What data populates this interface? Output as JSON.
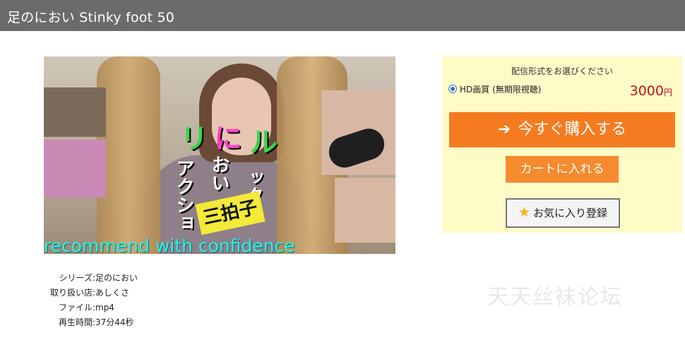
{
  "header": {
    "title": "足のにおい Stinky foot 50"
  },
  "thumbnail": {
    "overlay_green": "リ",
    "overlay_pink": "に",
    "overlay_green2": "ル",
    "overlay_white1": "アクショ",
    "overlay_white2": "おい",
    "overlay_white3": "ックス",
    "badge": "三拍子",
    "caption": "recommend with confidence"
  },
  "info": [
    {
      "label": "シリーズ",
      "value": "足のにおい",
      "link": true
    },
    {
      "label": "取り扱い店",
      "value": "あしくさ",
      "link": true
    },
    {
      "label": "ファイル",
      "value": "mp4",
      "link": false
    },
    {
      "label": "再生時間",
      "value": "37分44秒",
      "link": false
    }
  ],
  "purchase": {
    "heading": "配信形式をお選びください",
    "option_label": "HD画質 (無期限視聴)",
    "price": "3000",
    "currency": "円",
    "buy_button": "今すぐ購入する",
    "cart_button": "カートに入れる",
    "favorite_button": "お気に入り登録",
    "accent_color": "#f47b1f"
  },
  "watermark": "天天丝袜论坛"
}
